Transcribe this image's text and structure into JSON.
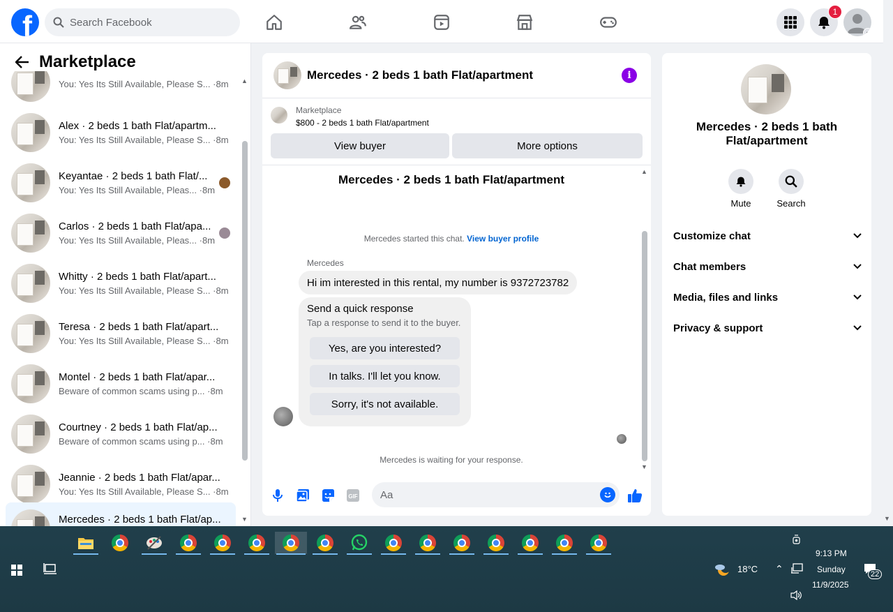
{
  "topbar": {
    "search_placeholder": "Search Facebook",
    "notification_count": "1",
    "colors": {
      "brand": "#0866ff",
      "badge": "#e41e3f"
    }
  },
  "sidebar": {
    "title": "Marketplace",
    "threads": [
      {
        "name": "",
        "preview": "You: Yes Its Still Available, Please S...",
        "time": "·8m"
      },
      {
        "name": "Alex · 2 beds 1 bath Flat/apartm...",
        "preview": "You: Yes Its Still Available, Please S...",
        "time": "·8m"
      },
      {
        "name": "Keyantae · 2 beds 1 bath Flat/...",
        "preview": "You: Yes Its Still Available, Pleas...",
        "time": "·8m"
      },
      {
        "name": "Carlos · 2 beds 1 bath Flat/apa...",
        "preview": "You: Yes Its Still Available, Pleas...",
        "time": "·8m"
      },
      {
        "name": "Whitty · 2 beds 1 bath Flat/apart...",
        "preview": "You: Yes Its Still Available, Please S...",
        "time": "·8m"
      },
      {
        "name": "Teresa · 2 beds 1 bath Flat/apart...",
        "preview": "You: Yes Its Still Available, Please S...",
        "time": "·8m"
      },
      {
        "name": "Montel · 2 beds 1 bath Flat/apar...",
        "preview": "Beware of common scams using p...",
        "time": "·8m"
      },
      {
        "name": "Courtney · 2 beds 1 bath Flat/ap...",
        "preview": "Beware of common scams using p...",
        "time": "·8m"
      },
      {
        "name": "Jeannie · 2 beds 1 bath Flat/apar...",
        "preview": "You: Yes Its Still Available, Please S...",
        "time": "·8m"
      },
      {
        "name": "Mercedes · 2 beds 1 bath Flat/ap...",
        "preview": "",
        "time": ""
      }
    ]
  },
  "chat": {
    "title": "Mercedes · 2 beds 1 bath Flat/apartment",
    "listing_source": "Marketplace",
    "listing_price": "$800 - 2 beds 1 bath Flat/apartment",
    "view_buyer": "View buyer",
    "more_options": "More options",
    "conversation_title": "Mercedes · 2 beds 1 bath Flat/apartment",
    "started_text": "Mercedes started this chat.",
    "view_profile": "View buyer profile",
    "sender": "Mercedes",
    "message": "Hi im interested in this rental, my number is 9372723782",
    "quick_title": "Send a quick response",
    "quick_sub": "Tap a response to send it to the buyer.",
    "quick_responses": [
      "Yes, are you interested?",
      "In talks. I'll let you know.",
      "Sorry, it's not available."
    ],
    "waiting": "Mercedes is waiting for your response.",
    "composer_placeholder": "Aa",
    "colors": {
      "accent": "#0866ff",
      "info": "#8a00e6",
      "link": "#0064d1"
    }
  },
  "rpanel": {
    "title": "Mercedes · 2 beds 1 bath Flat/apartment",
    "mute": "Mute",
    "search": "Search",
    "sections": [
      "Customize chat",
      "Chat members",
      "Media, files and links",
      "Privacy & support"
    ]
  },
  "taskbar": {
    "temperature": "18°C",
    "time": "9:13 PM",
    "day": "Sunday",
    "date": "11/9/2025",
    "notif_count": "22",
    "apps": [
      "file-explorer",
      "chrome",
      "paint",
      "chrome-profile-1",
      "chrome-profile-2",
      "chrome-profile-3",
      "chrome-profile-4",
      "chrome-profile-5",
      "whatsapp",
      "chrome-profile-6",
      "chrome-profile-7",
      "chrome-profile-8",
      "chrome-profile-9",
      "chrome-profile-10",
      "chrome-profile-11",
      "chrome-profile-12"
    ]
  }
}
